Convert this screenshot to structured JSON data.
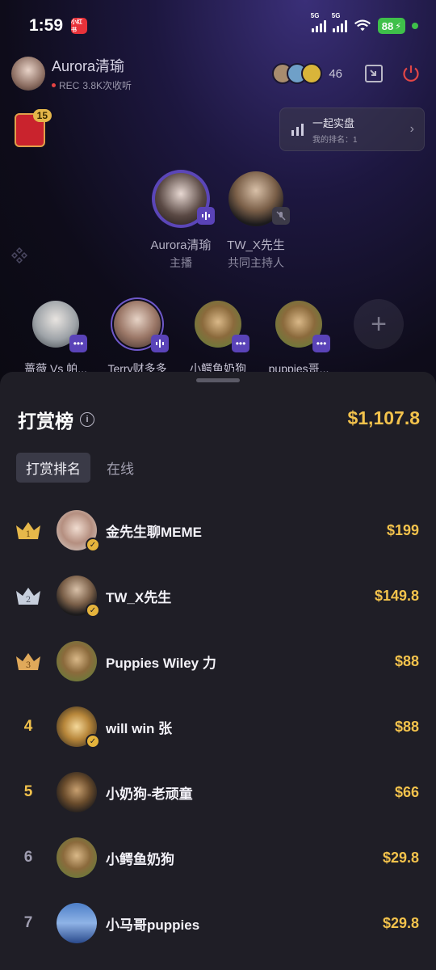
{
  "status_bar": {
    "time": "1:59",
    "notif_label": "小红书",
    "net1": "5G",
    "net2": "5G",
    "battery": "88"
  },
  "host": {
    "name": "Aurora清瑜",
    "rec_label": "REC",
    "listens": "3.8K次收听",
    "viewer_count": "46"
  },
  "gift": {
    "badge": "15"
  },
  "rank_card": {
    "title": "一起实盘",
    "sub": "我的排名：1"
  },
  "main_seats": [
    {
      "name": "Aurora清瑜",
      "role": "主播"
    },
    {
      "name": "TW_X先生",
      "role": "共同主持人"
    }
  ],
  "guests": [
    {
      "name": "蔷薇 Vs 帕..."
    },
    {
      "name": "Terry财多多"
    },
    {
      "name": "小鳄鱼奶狗"
    },
    {
      "name": "puppies哥..."
    }
  ],
  "panel": {
    "title": "打赏榜",
    "total": "$1,107.8",
    "tabs": [
      "打赏排名",
      "在线"
    ]
  },
  "leaderboard": [
    {
      "rank": "1",
      "name": "金先生聊MEME",
      "amount": "$199",
      "crown": "gold",
      "verified": true
    },
    {
      "rank": "2",
      "name": "TW_X先生",
      "amount": "$149.8",
      "crown": "silver",
      "verified": true
    },
    {
      "rank": "3",
      "name": "Puppies Wiley 力",
      "amount": "$88",
      "crown": "bronze",
      "verified": false
    },
    {
      "rank": "4",
      "name": "will win 张",
      "amount": "$88",
      "crown": "",
      "verified": true
    },
    {
      "rank": "5",
      "name": "小奶狗-老顽童",
      "amount": "$66",
      "crown": "",
      "verified": false
    },
    {
      "rank": "6",
      "name": "小鳄鱼奶狗",
      "amount": "$29.8",
      "crown": "",
      "verified": false
    },
    {
      "rank": "7",
      "name": "小马哥puppies",
      "amount": "$29.8",
      "crown": "",
      "verified": false
    }
  ],
  "colors": {
    "accent_gold": "#f2c24c",
    "panel_bg": "#1f1e26",
    "mic_badge": "#5a43b8",
    "battery": "#3fc04a"
  }
}
